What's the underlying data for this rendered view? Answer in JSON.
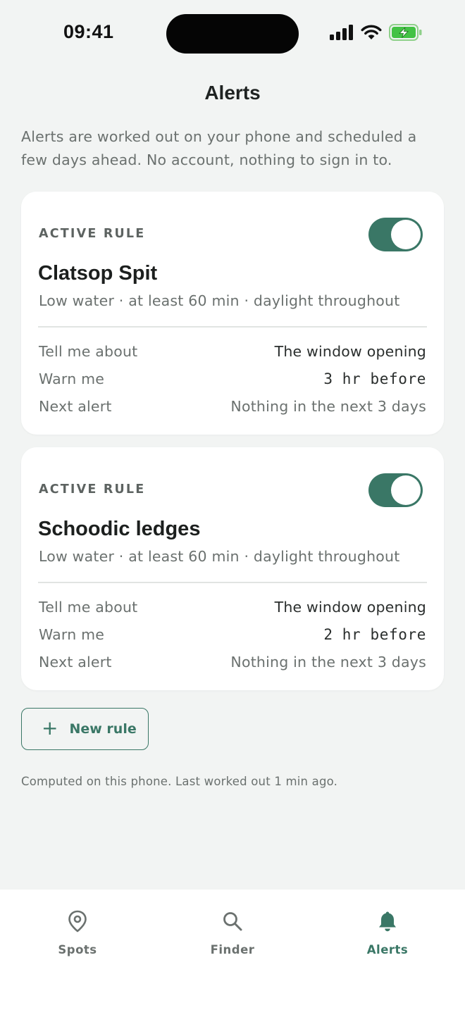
{
  "status_bar": {
    "time": "09:41",
    "icons": [
      "cellular-signal-icon",
      "wifi-icon",
      "battery-charging-icon"
    ]
  },
  "header": {
    "title": "Alerts",
    "intro": "Alerts are worked out on your phone and scheduled a few days ahead. No account, nothing to sign in to."
  },
  "rules": [
    {
      "eyebrow": "ACTIVE RULE",
      "enabled": true,
      "name": "Clatsop Spit",
      "summary": "Low water · at least 60 min · daylight throughout",
      "rows": [
        {
          "label": "Tell me about",
          "value": "The window opening"
        },
        {
          "label": "Warn me",
          "value": "3 hr before"
        },
        {
          "label": "Next alert",
          "value": "Nothing in the next 3 days"
        }
      ]
    },
    {
      "eyebrow": "ACTIVE RULE",
      "enabled": true,
      "name": "Schoodic ledges",
      "summary": "Low water · at least 60 min · daylight throughout",
      "rows": [
        {
          "label": "Tell me about",
          "value": "The window opening"
        },
        {
          "label": "Warn me",
          "value": "2 hr before"
        },
        {
          "label": "Next alert",
          "value": "Nothing in the next 3 days"
        }
      ]
    }
  ],
  "new_rule": {
    "icon": "plus-icon",
    "label": "New rule"
  },
  "footnote": "Computed on this phone. Last worked out 1 min ago.",
  "tab_bar": {
    "active": "Alerts",
    "tabs": [
      {
        "label": "Spots",
        "icon": "location-pin-icon"
      },
      {
        "label": "Finder",
        "icon": "search-icon"
      },
      {
        "label": "Alerts",
        "icon": "bell-icon"
      }
    ]
  },
  "colors": {
    "accent": "#3a7766",
    "background": "#f2f4f3",
    "card": "#ffffff",
    "muted_text": "#6b716f"
  }
}
